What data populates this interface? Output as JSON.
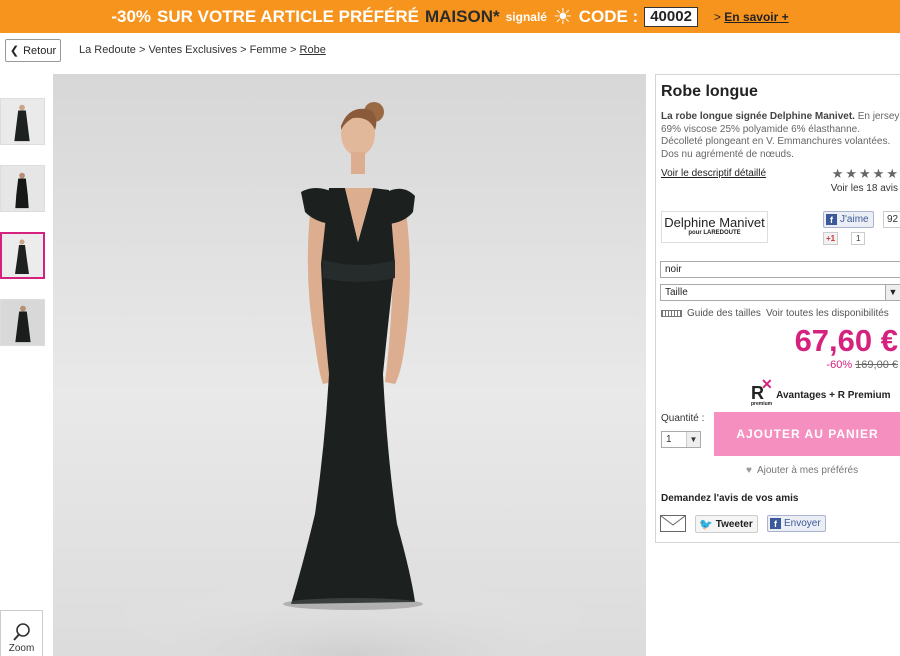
{
  "promo": {
    "discount": "-30%",
    "text": "SUR VOTRE ARTICLE PRÉFÉRÉ",
    "brand": "MAISON*",
    "signaled": "signalé",
    "sun_icon": "☀",
    "code_label": "CODE :",
    "code": "40002",
    "more_prefix": ">",
    "more": "En savoir +"
  },
  "nav": {
    "back_label": "Retour",
    "breadcrumb": [
      {
        "label": "La Redoute"
      },
      {
        "label": "Ventes Exclusives"
      },
      {
        "label": "Femme"
      },
      {
        "label": "Robe"
      }
    ],
    "separator": ">"
  },
  "gallery": {
    "zoom_label": "Zoom"
  },
  "product": {
    "title": "Robe longue",
    "desc_bold": "La robe longue signée Delphine Manivet.",
    "desc": "En jersey 69% viscose 25% polyamide 6% élasthanne. Décolleté plongeant en V. Emmanchures volantées. Dos nu agrémenté de nœuds.",
    "detail_link": "Voir le descriptif détaillé",
    "rating_stars": "★★★★★",
    "reviews": "Voir les 18 avis",
    "brand_name": "Delphine Manivet",
    "brand_sub": "pour LAREDOUTE",
    "fb_like_label": "J'aime",
    "fb_like_count": "92",
    "gplus_label": "+1",
    "gplus_count": "1",
    "color": "noir",
    "size_placeholder": "Taille",
    "size_guide": "Guide des tailles",
    "availability": "Voir toutes les disponibilités",
    "price": "67,60 €",
    "discount_pct": "-60%",
    "old_price": "169,00 €",
    "premium_label": "Avantages + R Premium",
    "premium_logo": "R",
    "premium_logo_sub": "premium",
    "qty_label": "Quantité :",
    "qty_value": "1",
    "cart_button": "AJOUTER AU PANIER",
    "favorites": "Ajouter à mes préférés",
    "ask_friends": "Demandez l'avis de vos amis",
    "tweet": "Tweeter",
    "fb_send": "Envoyer"
  },
  "colors": {
    "promo_bg": "#f7941d",
    "accent_pink": "#d4227e",
    "cart_button_bg": "#f48fbf",
    "facebook_blue": "#3b5998"
  }
}
